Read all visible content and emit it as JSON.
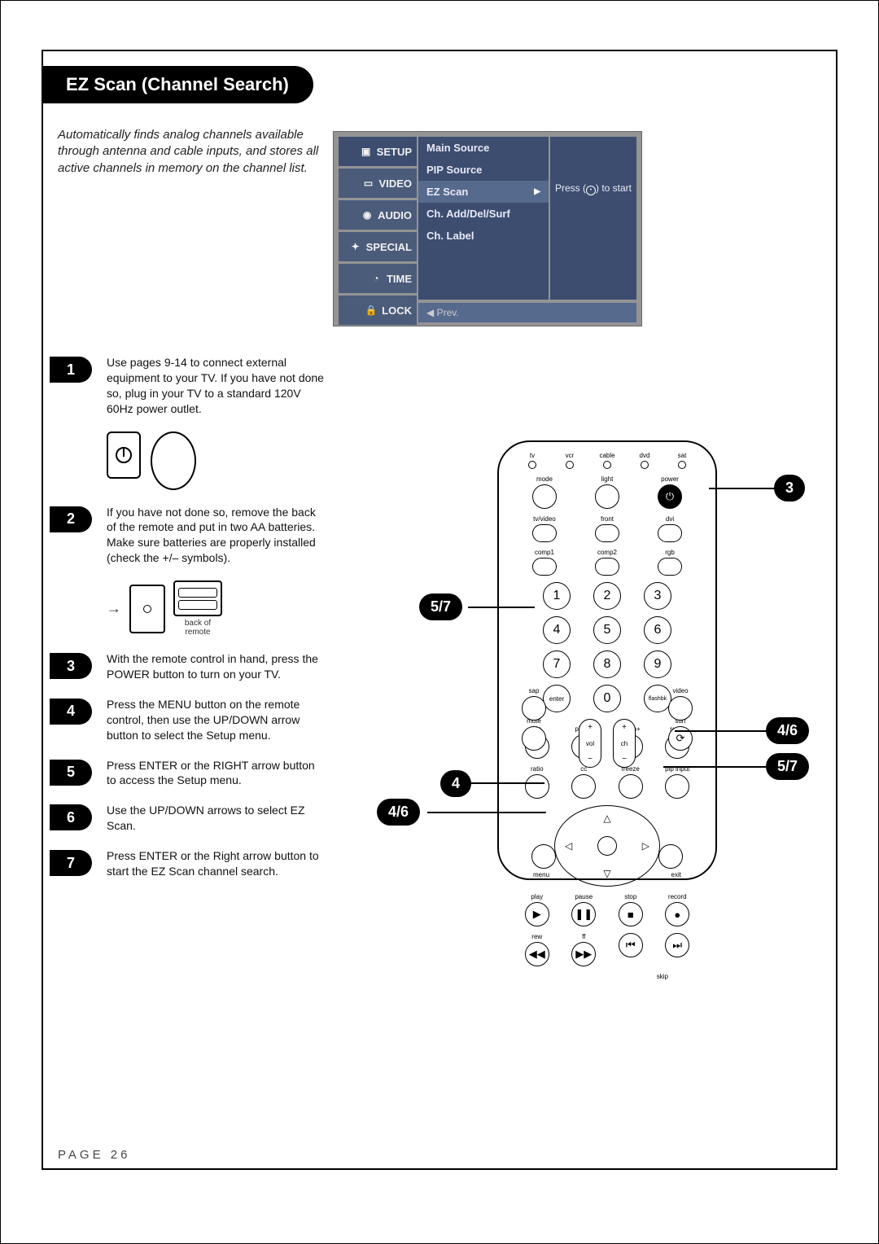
{
  "page": {
    "title": "EZ Scan (Channel Search)",
    "page_label": "PAGE 26",
    "intro": "Automatically finds analog channels available through antenna and cable inputs, and stores all active channels in memory on the channel list."
  },
  "osd": {
    "tabs": [
      "SETUP",
      "VIDEO",
      "AUDIO",
      "SPECIAL",
      "TIME",
      "LOCK"
    ],
    "items": [
      "Main Source",
      "PIP Source",
      "EZ Scan",
      "Ch. Add/Del/Surf",
      "Ch. Label"
    ],
    "highlight_index": 2,
    "detail_prefix": "Press (",
    "detail_suffix": ") to start",
    "footer": "◀ Prev."
  },
  "steps": [
    {
      "n": "1",
      "text": "Use pages 9-14 to connect external equipment to your TV. If you have not done so, plug in your TV to a standard 120V 60Hz power outlet.",
      "illus": "plug"
    },
    {
      "n": "2",
      "text": "If you have not done so, remove the back of the remote and put in two AA batteries. Make sure batteries are properly installed (check the +/– symbols).",
      "illus": "battery"
    },
    {
      "n": "3",
      "text": "With the remote control in hand, press the POWER button to turn on your TV."
    },
    {
      "n": "4",
      "text": "Press the MENU button on the remote control, then use the UP/DOWN arrow button to select the Setup menu."
    },
    {
      "n": "5",
      "text": "Press ENTER or the RIGHT arrow button to access the Setup menu."
    },
    {
      "n": "6",
      "text": "Use the UP/DOWN arrows to select EZ Scan."
    },
    {
      "n": "7",
      "text": "Press ENTER or the Right arrow button to start the EZ Scan channel search."
    }
  ],
  "illus": {
    "back_of_remote": "back of\nremote"
  },
  "remote": {
    "devices": [
      "tv",
      "vcr",
      "cable",
      "dvd",
      "sat"
    ],
    "row1": [
      "mode",
      "light",
      "power"
    ],
    "row2": [
      "tv/video",
      "front",
      "dvi"
    ],
    "row3": [
      "comp1",
      "comp2",
      "rgb"
    ],
    "numpad": [
      "1",
      "2",
      "3",
      "4",
      "5",
      "6",
      "7",
      "8",
      "9",
      "0"
    ],
    "enter": "enter",
    "flashbk": "flashbk",
    "mute": "mute",
    "surf": "surf",
    "sap": "sap",
    "video": "video",
    "vol": "vol",
    "ch": "ch",
    "pip_row": [
      "pip",
      "pipch-",
      "pipch+",
      "swap"
    ],
    "ratio_row": [
      "ratio",
      "cc",
      "freeze",
      "pip input"
    ],
    "menu": "menu",
    "exit": "exit",
    "transport": [
      "play",
      "pause",
      "stop",
      "record"
    ],
    "transport2": [
      "rew",
      "ff",
      "",
      ""
    ],
    "skip": "skip"
  },
  "callouts": {
    "c3": "3",
    "c57": "5/7",
    "c46": "4/6",
    "c4": "4"
  }
}
